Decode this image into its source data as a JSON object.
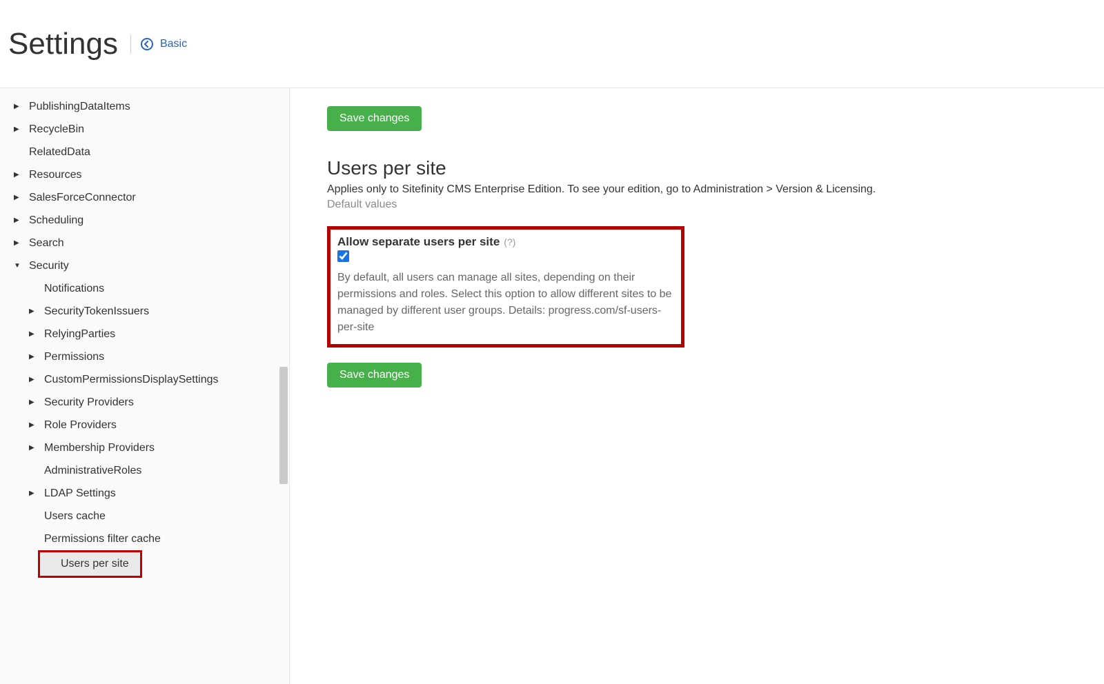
{
  "header": {
    "title": "Settings",
    "back_label": "Basic"
  },
  "buttons": {
    "save": "Save changes"
  },
  "sidebar": {
    "items": [
      {
        "label": "PublishingDataItems",
        "level": 1,
        "caret": "right"
      },
      {
        "label": "RecycleBin",
        "level": 1,
        "caret": "right"
      },
      {
        "label": "RelatedData",
        "level": 1,
        "caret": "none"
      },
      {
        "label": "Resources",
        "level": 1,
        "caret": "right"
      },
      {
        "label": "SalesForceConnector",
        "level": 1,
        "caret": "right"
      },
      {
        "label": "Scheduling",
        "level": 1,
        "caret": "right"
      },
      {
        "label": "Search",
        "level": 1,
        "caret": "right"
      },
      {
        "label": "Security",
        "level": 1,
        "caret": "down"
      },
      {
        "label": "Notifications",
        "level": 2,
        "caret": "none"
      },
      {
        "label": "SecurityTokenIssuers",
        "level": 2,
        "caret": "right"
      },
      {
        "label": "RelyingParties",
        "level": 2,
        "caret": "right"
      },
      {
        "label": "Permissions",
        "level": 2,
        "caret": "right"
      },
      {
        "label": "CustomPermissionsDisplaySettings",
        "level": 2,
        "caret": "right"
      },
      {
        "label": "Security Providers",
        "level": 2,
        "caret": "right"
      },
      {
        "label": "Role Providers",
        "level": 2,
        "caret": "right"
      },
      {
        "label": "Membership Providers",
        "level": 2,
        "caret": "right"
      },
      {
        "label": "AdministrativeRoles",
        "level": 2,
        "caret": "none"
      },
      {
        "label": "LDAP Settings",
        "level": 2,
        "caret": "right"
      },
      {
        "label": "Users cache",
        "level": 2,
        "caret": "none"
      },
      {
        "label": "Permissions filter cache",
        "level": 2,
        "caret": "none"
      },
      {
        "label": "Users per site",
        "level": 2,
        "caret": "none",
        "selected": true,
        "highlight": true
      }
    ]
  },
  "main": {
    "title": "Users per site",
    "subtitle": "Applies only to Sitefinity CMS Enterprise Edition. To see your edition, go to Administration > Version & Licensing.",
    "default_values": "Default values",
    "setting": {
      "label": "Allow separate users per site",
      "help": "(?)",
      "checked": true,
      "description": "By default, all users can manage all sites, depending on their permissions and roles. Select this option to allow different sites to be managed by different user groups. Details: progress.com/sf-users-per-site"
    }
  }
}
